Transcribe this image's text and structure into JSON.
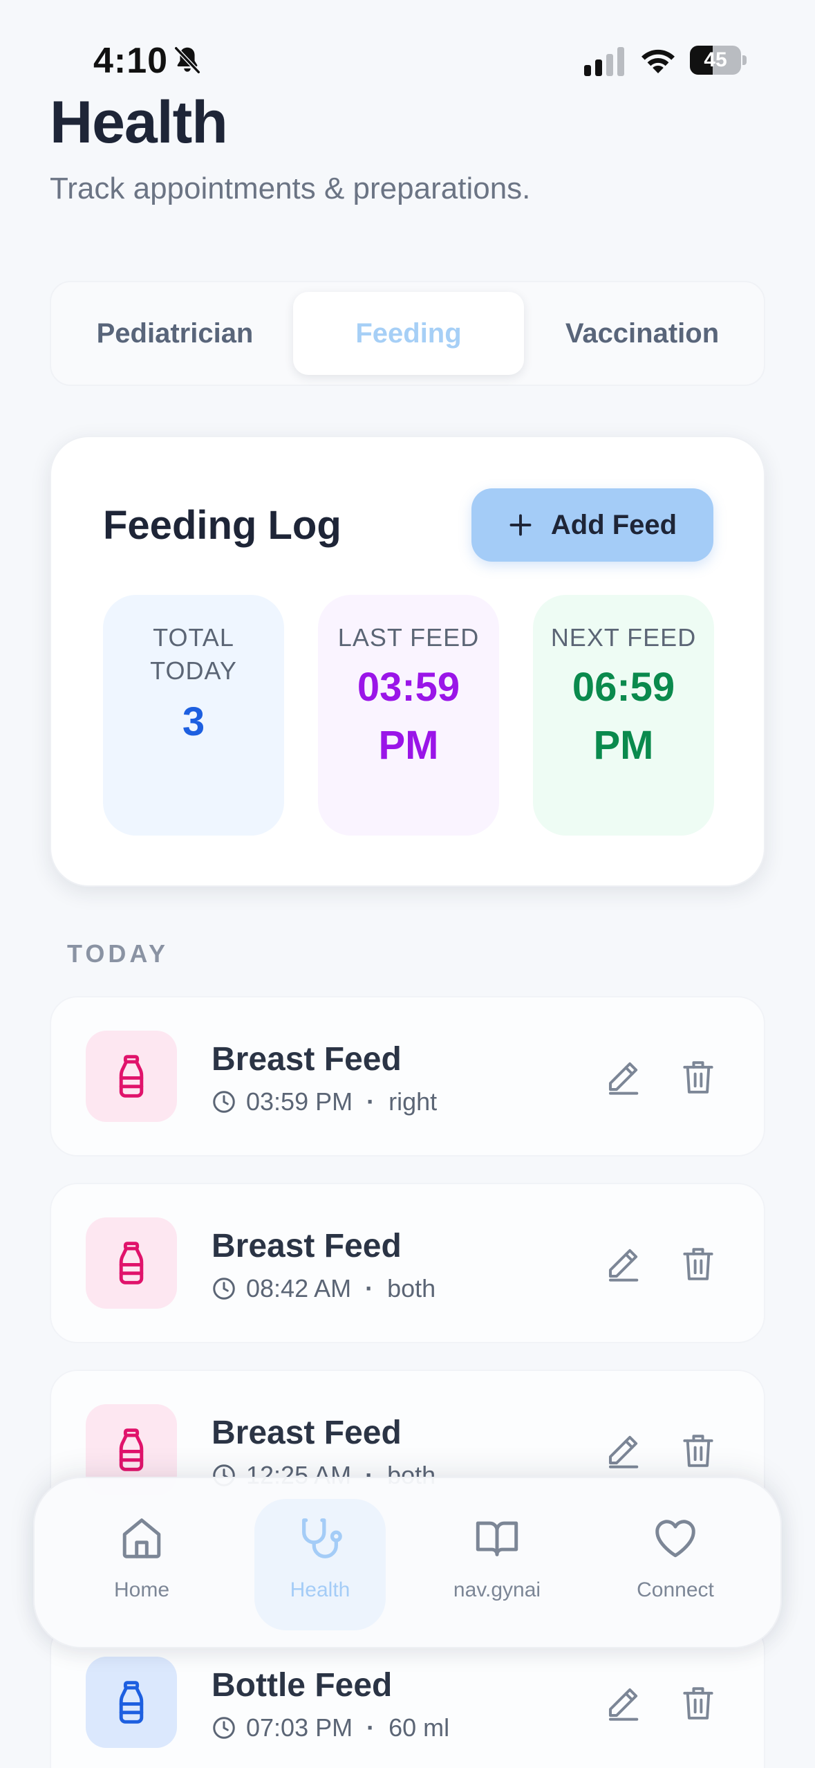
{
  "status_bar": {
    "time": "4:10",
    "battery": "45",
    "battery_level": 0.45
  },
  "header": {
    "title": "Health",
    "subtitle": "Track appointments & preparations."
  },
  "tabs": [
    {
      "label": "Pediatrician",
      "active": false
    },
    {
      "label": "Feeding",
      "active": true
    },
    {
      "label": "Vaccination",
      "active": false
    }
  ],
  "feeding_card": {
    "title": "Feeding Log",
    "add_button": "Add Feed",
    "stats": [
      {
        "label": "TOTAL TODAY",
        "value": "3"
      },
      {
        "label": "LAST FEED",
        "value": "03:59 PM"
      },
      {
        "label": "NEXT FEED",
        "value": "06:59 PM"
      }
    ]
  },
  "today": {
    "label": "TODAY",
    "items": [
      {
        "title": "Breast Feed",
        "time": "03:59 PM",
        "detail": "right",
        "kind": "breast"
      },
      {
        "title": "Breast Feed",
        "time": "08:42 AM",
        "detail": "both",
        "kind": "breast"
      },
      {
        "title": "Breast Feed",
        "time": "12:25 AM",
        "detail": "both",
        "kind": "breast"
      },
      {
        "title": "Bottle Feed",
        "time": "07:03 PM",
        "detail": "60 ml",
        "kind": "bottle"
      }
    ]
  },
  "bottom_nav": [
    {
      "label": "Home",
      "icon": "home-icon",
      "active": false
    },
    {
      "label": "Health",
      "icon": "stethoscope-icon",
      "active": true
    },
    {
      "label": "nav.gynai",
      "icon": "book-icon",
      "active": false
    },
    {
      "label": "Connect",
      "icon": "heart-icon",
      "active": false
    }
  ],
  "colors": {
    "accent": "#a4ccf7",
    "breast_icon": "#e0136b",
    "bottle_icon": "#1d5fe0",
    "total_value": "#1d5fe0",
    "last_value": "#9a15e8",
    "next_value": "#0a8a4d"
  }
}
